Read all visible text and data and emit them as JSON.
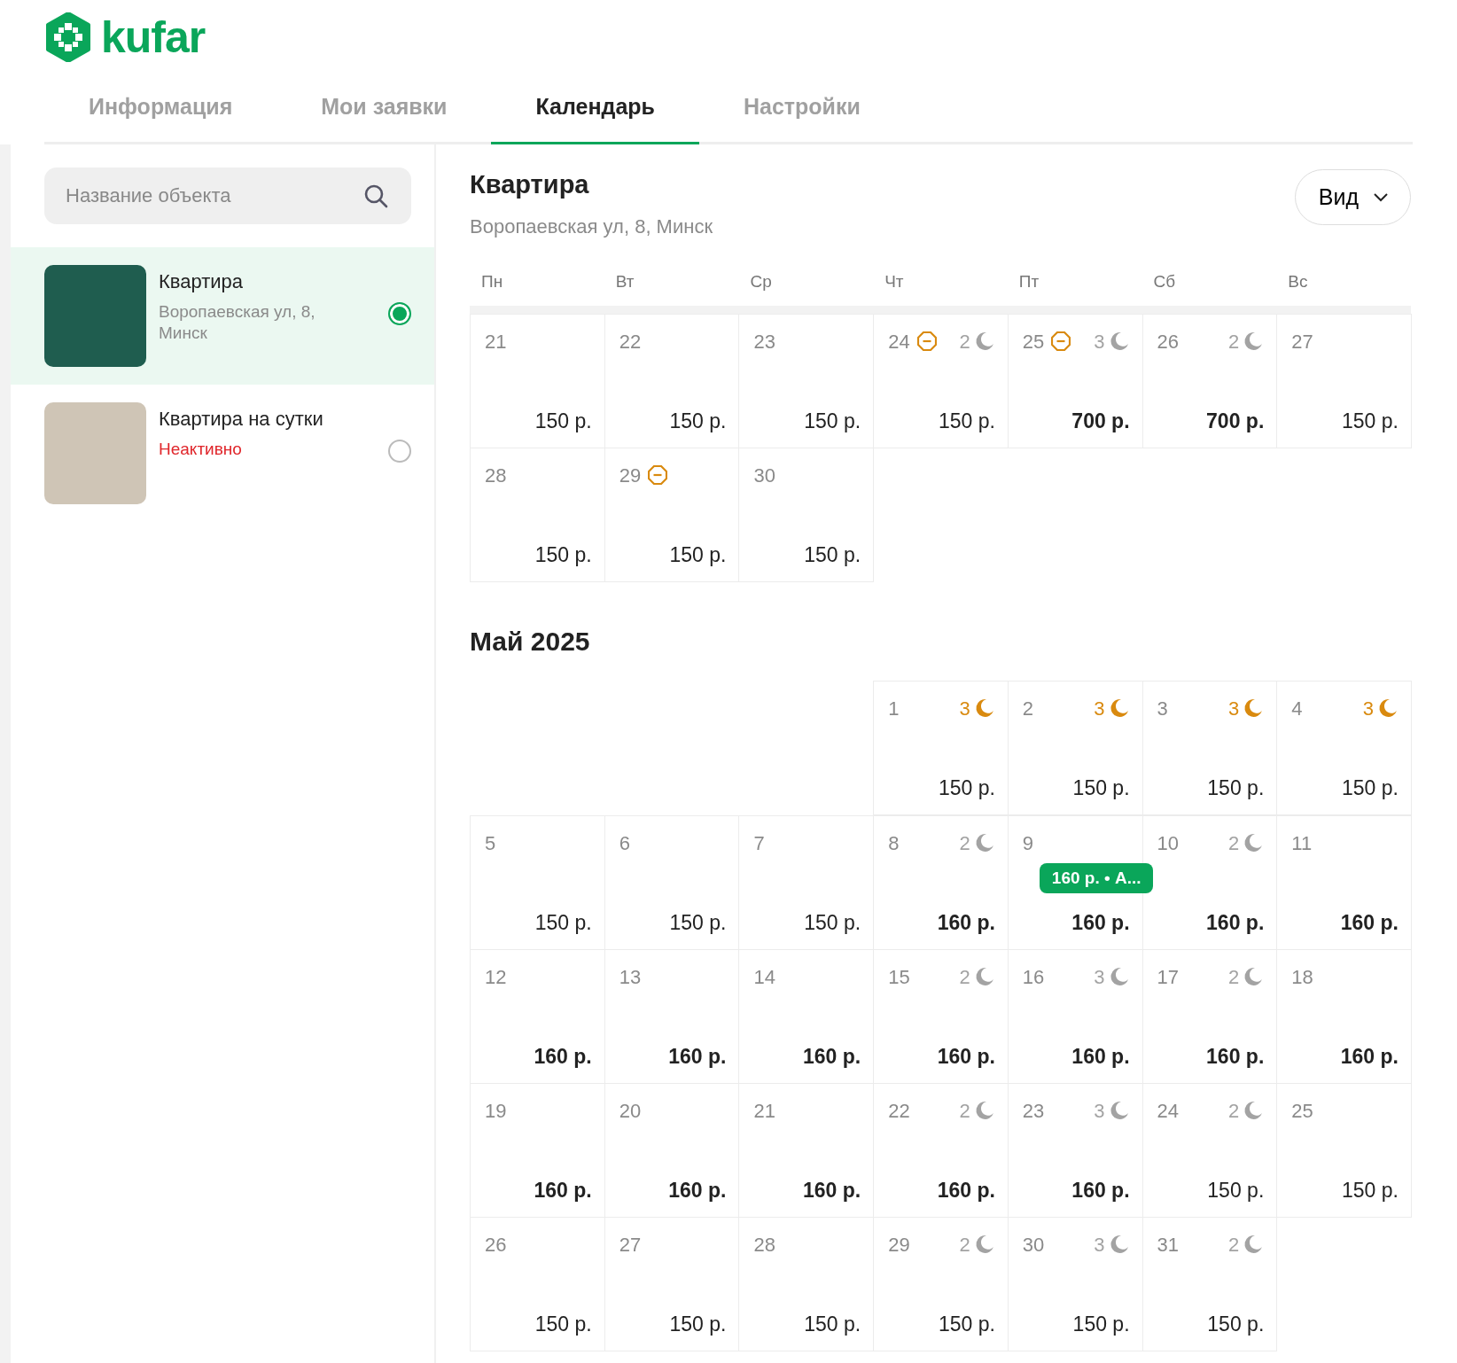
{
  "logo": {
    "text": "kufar"
  },
  "tabs": [
    {
      "label": "Информация",
      "selected": false
    },
    {
      "label": "Мои заявки",
      "selected": false
    },
    {
      "label": "Календарь",
      "selected": true
    },
    {
      "label": "Настройки",
      "selected": false
    }
  ],
  "sidebar": {
    "search": {
      "placeholder": "Название объекта"
    },
    "items": [
      {
        "title": "Квартира",
        "subtitle": "Воропаевская ул, 8, Минск",
        "kind": "address",
        "selected": true
      },
      {
        "title": "Квартира на сутки",
        "subtitle": "Неактивно",
        "kind": "inactive",
        "selected": false
      }
    ]
  },
  "header": {
    "title": "Квартира",
    "address": "Воропаевская ул, 8, Минск",
    "view_button": "Вид"
  },
  "weekdays": [
    "Пн",
    "Вт",
    "Ср",
    "Чт",
    "Пт",
    "Сб",
    "Вс"
  ],
  "months": [
    {
      "weeks": [
        [
          {
            "kind": "day",
            "day": "21",
            "price": "150 р.",
            "special": false
          },
          {
            "kind": "day",
            "day": "22",
            "price": "150 р.",
            "special": false
          },
          {
            "kind": "day",
            "day": "23",
            "price": "150 р.",
            "special": false
          },
          {
            "kind": "day",
            "day": "24",
            "blocked": true,
            "nights": {
              "text": "2",
              "color": "#a3a3a3"
            },
            "price": "150 р.",
            "special": false
          },
          {
            "kind": "day",
            "day": "25",
            "blocked": true,
            "nights": {
              "text": "3",
              "color": "#a3a3a3"
            },
            "price": "700 р.",
            "special": true
          },
          {
            "kind": "day",
            "day": "26",
            "nights": {
              "text": "2",
              "color": "#a3a3a3"
            },
            "price": "700 р.",
            "special": true
          },
          {
            "kind": "day",
            "day": "27",
            "price": "150 р.",
            "special": false
          }
        ],
        [
          {
            "kind": "day",
            "day": "28",
            "price": "150 р.",
            "special": false
          },
          {
            "kind": "day",
            "day": "29",
            "blocked": true,
            "price": "150 р.",
            "special": false
          },
          {
            "kind": "day",
            "day": "30",
            "price": "150 р.",
            "special": false
          },
          {
            "kind": "blank"
          },
          {
            "kind": "blank"
          },
          {
            "kind": "blank"
          },
          {
            "kind": "blank"
          }
        ]
      ]
    },
    {
      "title": "Май 2025",
      "weeks": [
        [
          {
            "kind": "blank"
          },
          {
            "kind": "blank"
          },
          {
            "kind": "blank"
          },
          {
            "kind": "day",
            "day": "1",
            "nights": {
              "text": "3",
              "color": "#d98a0f"
            },
            "price": "150 р.",
            "special": false
          },
          {
            "kind": "day",
            "day": "2",
            "nights": {
              "text": "3",
              "color": "#d98a0f"
            },
            "price": "150 р.",
            "special": false
          },
          {
            "kind": "day",
            "day": "3",
            "nights": {
              "text": "3",
              "color": "#d98a0f"
            },
            "price": "150 р.",
            "special": false
          },
          {
            "kind": "day",
            "day": "4",
            "nights": {
              "text": "3",
              "color": "#d98a0f"
            },
            "price": "150 р.",
            "special": false
          }
        ],
        [
          {
            "kind": "day",
            "day": "5",
            "price": "150 р.",
            "special": false
          },
          {
            "kind": "day",
            "day": "6",
            "price": "150 р.",
            "special": false
          },
          {
            "kind": "day",
            "day": "7",
            "price": "150 р.",
            "special": false
          },
          {
            "kind": "day",
            "day": "8",
            "nights": {
              "text": "2",
              "color": "#a3a3a3"
            },
            "price": "160 р.",
            "special": true
          },
          {
            "kind": "day",
            "day": "9",
            "booking": "160 р. • А...",
            "price": "160 р.",
            "special": true
          },
          {
            "kind": "day",
            "day": "10",
            "nights": {
              "text": "2",
              "color": "#a3a3a3"
            },
            "price": "160 р.",
            "special": true
          },
          {
            "kind": "day",
            "day": "11",
            "price": "160 р.",
            "special": true
          }
        ],
        [
          {
            "kind": "day",
            "day": "12",
            "price": "160 р.",
            "special": true
          },
          {
            "kind": "day",
            "day": "13",
            "price": "160 р.",
            "special": true
          },
          {
            "kind": "day",
            "day": "14",
            "price": "160 р.",
            "special": true
          },
          {
            "kind": "day",
            "day": "15",
            "nights": {
              "text": "2",
              "color": "#a3a3a3"
            },
            "price": "160 р.",
            "special": true
          },
          {
            "kind": "day",
            "day": "16",
            "nights": {
              "text": "3",
              "color": "#a3a3a3"
            },
            "price": "160 р.",
            "special": true
          },
          {
            "kind": "day",
            "day": "17",
            "nights": {
              "text": "2",
              "color": "#a3a3a3"
            },
            "price": "160 р.",
            "special": true
          },
          {
            "kind": "day",
            "day": "18",
            "price": "160 р.",
            "special": true
          }
        ],
        [
          {
            "kind": "day",
            "day": "19",
            "price": "160 р.",
            "special": true
          },
          {
            "kind": "day",
            "day": "20",
            "price": "160 р.",
            "special": true
          },
          {
            "kind": "day",
            "day": "21",
            "price": "160 р.",
            "special": true
          },
          {
            "kind": "day",
            "day": "22",
            "nights": {
              "text": "2",
              "color": "#a3a3a3"
            },
            "price": "160 р.",
            "special": true
          },
          {
            "kind": "day",
            "day": "23",
            "nights": {
              "text": "3",
              "color": "#a3a3a3"
            },
            "price": "160 р.",
            "special": true
          },
          {
            "kind": "day",
            "day": "24",
            "nights": {
              "text": "2",
              "color": "#a3a3a3"
            },
            "price": "150 р.",
            "special": false
          },
          {
            "kind": "day",
            "day": "25",
            "price": "150 р.",
            "special": false
          }
        ],
        [
          {
            "kind": "day",
            "day": "26",
            "price": "150 р.",
            "special": false
          },
          {
            "kind": "day",
            "day": "27",
            "price": "150 р.",
            "special": false
          },
          {
            "kind": "day",
            "day": "28",
            "price": "150 р.",
            "special": false
          },
          {
            "kind": "day",
            "day": "29",
            "nights": {
              "text": "2",
              "color": "#a3a3a3"
            },
            "price": "150 р.",
            "special": false
          },
          {
            "kind": "day",
            "day": "30",
            "nights": {
              "text": "3",
              "color": "#a3a3a3"
            },
            "price": "150 р.",
            "special": false
          },
          {
            "kind": "day",
            "day": "31",
            "nights": {
              "text": "2",
              "color": "#a3a3a3"
            },
            "price": "150 р.",
            "special": false
          },
          {
            "kind": "blank"
          }
        ]
      ]
    }
  ]
}
